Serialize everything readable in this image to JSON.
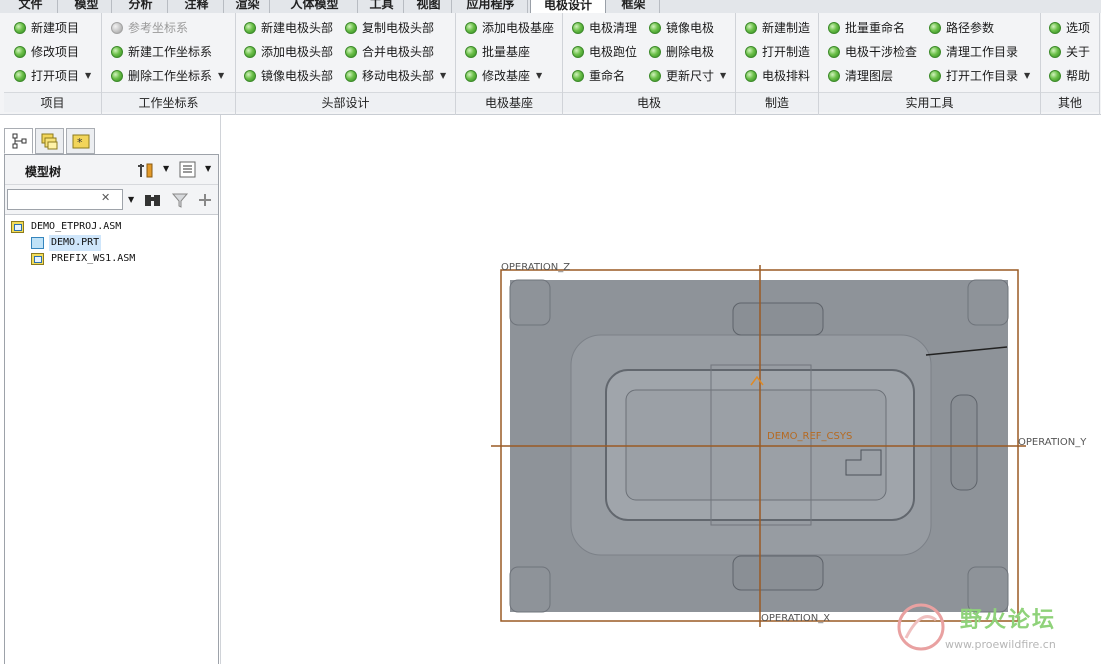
{
  "menubar": {
    "tabs": [
      "文件",
      "模型",
      "分析",
      "注释",
      "渲染",
      "人体模型",
      "工具",
      "视图",
      "应用程序",
      "电极设计",
      "框架"
    ],
    "active_tab": "电极设计"
  },
  "ribbon": {
    "groups": [
      {
        "label": "项目",
        "items": [
          {
            "label": "新建项目"
          },
          {
            "label": "修改项目"
          },
          {
            "label": "打开项目",
            "dropdown": true
          }
        ]
      },
      {
        "label": "工作坐标系",
        "items": [
          {
            "label": "参考坐标系",
            "disabled": true
          },
          {
            "label": "新建工作坐标系"
          },
          {
            "label": "删除工作坐标系",
            "dropdown": true
          }
        ]
      },
      {
        "label": "头部设计",
        "items": [
          {
            "label": "新建电极头部"
          },
          {
            "label": "添加电极头部"
          },
          {
            "label": "镜像电极头部"
          },
          {
            "label": "复制电极头部"
          },
          {
            "label": "合并电极头部"
          },
          {
            "label": "移动电极头部",
            "dropdown": true
          }
        ]
      },
      {
        "label": "电极基座",
        "items": [
          {
            "label": "添加电极基座"
          },
          {
            "label": "批量基座"
          },
          {
            "label": "修改基座",
            "dropdown": true
          }
        ]
      },
      {
        "label": "电极",
        "items": [
          {
            "label": "电极清理"
          },
          {
            "label": "电极跑位"
          },
          {
            "label": "重命名"
          },
          {
            "label": "镜像电极"
          },
          {
            "label": "删除电极"
          },
          {
            "label": "更新尺寸",
            "dropdown": true
          }
        ]
      },
      {
        "label": "制造",
        "items": [
          {
            "label": "新建制造"
          },
          {
            "label": "打开制造"
          },
          {
            "label": "电极排料"
          }
        ]
      },
      {
        "label": "实用工具",
        "items": [
          {
            "label": "批量重命名"
          },
          {
            "label": "电极干涉检查"
          },
          {
            "label": "清理图层"
          },
          {
            "label": "路径参数"
          },
          {
            "label": "清理工作目录"
          },
          {
            "label": "打开工作目录",
            "dropdown": true
          }
        ]
      },
      {
        "label": "其他",
        "items": [
          {
            "label": "选项"
          },
          {
            "label": "关于"
          },
          {
            "label": "帮助"
          }
        ]
      }
    ]
  },
  "tree": {
    "title": "模型树",
    "search_value": "",
    "clear_symbol": "✕",
    "nodes": [
      {
        "label": "DEMO_ETPROJ.ASM",
        "type": "asm"
      },
      {
        "label": "DEMO.PRT",
        "type": "prt",
        "selected": true
      },
      {
        "label": "PREFIX_WS1.ASM",
        "type": "asm"
      }
    ]
  },
  "viewport": {
    "labels": {
      "operation_z": "OPERATION_Z",
      "operation_y": "OPERATION_Y",
      "operation_x": "OPERATION_X",
      "csys": "DEMO_REF_CSYS"
    }
  },
  "watermark": {
    "text": "野火论坛",
    "url": "www.proewildfire.cn"
  },
  "colors": {
    "datum": "#9a5a24",
    "part": "#8e9399",
    "accent_green": "#6cc04a"
  }
}
